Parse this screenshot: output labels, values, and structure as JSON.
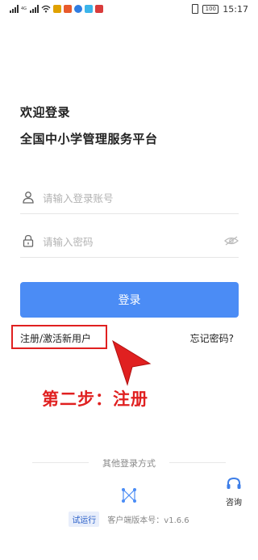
{
  "status_bar": {
    "time": "15:17",
    "battery": "100",
    "network_label": "4G"
  },
  "header": {
    "welcome": "欢迎登录",
    "platform_name": "全国中小学管理服务平台"
  },
  "form": {
    "account_placeholder": "请输入登录账号",
    "password_placeholder": "请输入密码",
    "login_label": "登录"
  },
  "links": {
    "register": "注册/激活新用户",
    "forgot": "忘记密码?"
  },
  "annotation": {
    "step_text": "第二步：注册"
  },
  "other_login": {
    "title": "其他登录方式"
  },
  "consult": {
    "label": "咨询"
  },
  "footer": {
    "trial_badge": "试运行",
    "version": "客户端版本号：v1.6.6"
  },
  "colors": {
    "primary": "#4b8cf5",
    "annotation_red": "#e02020"
  }
}
